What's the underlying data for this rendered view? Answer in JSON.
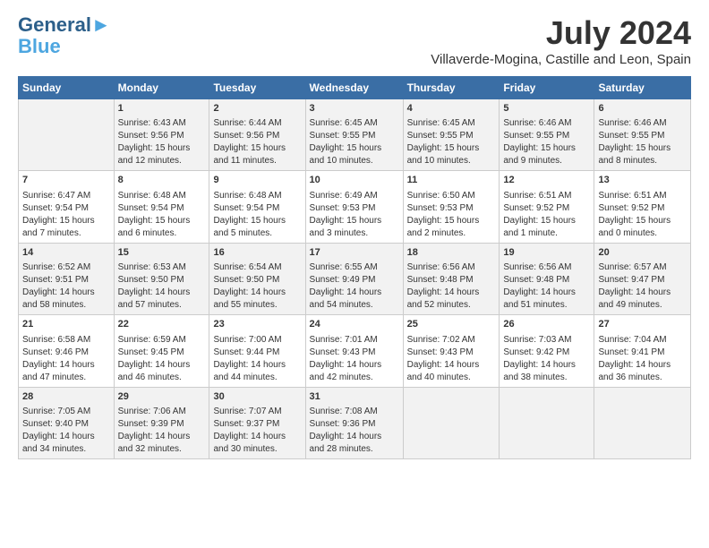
{
  "header": {
    "logo_line1": "General",
    "logo_line2": "Blue",
    "month": "July 2024",
    "location": "Villaverde-Mogina, Castille and Leon, Spain"
  },
  "days_of_week": [
    "Sunday",
    "Monday",
    "Tuesday",
    "Wednesday",
    "Thursday",
    "Friday",
    "Saturday"
  ],
  "weeks": [
    [
      {
        "day": "",
        "content": ""
      },
      {
        "day": "1",
        "content": "Sunrise: 6:43 AM\nSunset: 9:56 PM\nDaylight: 15 hours\nand 12 minutes."
      },
      {
        "day": "2",
        "content": "Sunrise: 6:44 AM\nSunset: 9:56 PM\nDaylight: 15 hours\nand 11 minutes."
      },
      {
        "day": "3",
        "content": "Sunrise: 6:45 AM\nSunset: 9:55 PM\nDaylight: 15 hours\nand 10 minutes."
      },
      {
        "day": "4",
        "content": "Sunrise: 6:45 AM\nSunset: 9:55 PM\nDaylight: 15 hours\nand 10 minutes."
      },
      {
        "day": "5",
        "content": "Sunrise: 6:46 AM\nSunset: 9:55 PM\nDaylight: 15 hours\nand 9 minutes."
      },
      {
        "day": "6",
        "content": "Sunrise: 6:46 AM\nSunset: 9:55 PM\nDaylight: 15 hours\nand 8 minutes."
      }
    ],
    [
      {
        "day": "7",
        "content": "Sunrise: 6:47 AM\nSunset: 9:54 PM\nDaylight: 15 hours\nand 7 minutes."
      },
      {
        "day": "8",
        "content": "Sunrise: 6:48 AM\nSunset: 9:54 PM\nDaylight: 15 hours\nand 6 minutes."
      },
      {
        "day": "9",
        "content": "Sunrise: 6:48 AM\nSunset: 9:54 PM\nDaylight: 15 hours\nand 5 minutes."
      },
      {
        "day": "10",
        "content": "Sunrise: 6:49 AM\nSunset: 9:53 PM\nDaylight: 15 hours\nand 3 minutes."
      },
      {
        "day": "11",
        "content": "Sunrise: 6:50 AM\nSunset: 9:53 PM\nDaylight: 15 hours\nand 2 minutes."
      },
      {
        "day": "12",
        "content": "Sunrise: 6:51 AM\nSunset: 9:52 PM\nDaylight: 15 hours\nand 1 minute."
      },
      {
        "day": "13",
        "content": "Sunrise: 6:51 AM\nSunset: 9:52 PM\nDaylight: 15 hours\nand 0 minutes."
      }
    ],
    [
      {
        "day": "14",
        "content": "Sunrise: 6:52 AM\nSunset: 9:51 PM\nDaylight: 14 hours\nand 58 minutes."
      },
      {
        "day": "15",
        "content": "Sunrise: 6:53 AM\nSunset: 9:50 PM\nDaylight: 14 hours\nand 57 minutes."
      },
      {
        "day": "16",
        "content": "Sunrise: 6:54 AM\nSunset: 9:50 PM\nDaylight: 14 hours\nand 55 minutes."
      },
      {
        "day": "17",
        "content": "Sunrise: 6:55 AM\nSunset: 9:49 PM\nDaylight: 14 hours\nand 54 minutes."
      },
      {
        "day": "18",
        "content": "Sunrise: 6:56 AM\nSunset: 9:48 PM\nDaylight: 14 hours\nand 52 minutes."
      },
      {
        "day": "19",
        "content": "Sunrise: 6:56 AM\nSunset: 9:48 PM\nDaylight: 14 hours\nand 51 minutes."
      },
      {
        "day": "20",
        "content": "Sunrise: 6:57 AM\nSunset: 9:47 PM\nDaylight: 14 hours\nand 49 minutes."
      }
    ],
    [
      {
        "day": "21",
        "content": "Sunrise: 6:58 AM\nSunset: 9:46 PM\nDaylight: 14 hours\nand 47 minutes."
      },
      {
        "day": "22",
        "content": "Sunrise: 6:59 AM\nSunset: 9:45 PM\nDaylight: 14 hours\nand 46 minutes."
      },
      {
        "day": "23",
        "content": "Sunrise: 7:00 AM\nSunset: 9:44 PM\nDaylight: 14 hours\nand 44 minutes."
      },
      {
        "day": "24",
        "content": "Sunrise: 7:01 AM\nSunset: 9:43 PM\nDaylight: 14 hours\nand 42 minutes."
      },
      {
        "day": "25",
        "content": "Sunrise: 7:02 AM\nSunset: 9:43 PM\nDaylight: 14 hours\nand 40 minutes."
      },
      {
        "day": "26",
        "content": "Sunrise: 7:03 AM\nSunset: 9:42 PM\nDaylight: 14 hours\nand 38 minutes."
      },
      {
        "day": "27",
        "content": "Sunrise: 7:04 AM\nSunset: 9:41 PM\nDaylight: 14 hours\nand 36 minutes."
      }
    ],
    [
      {
        "day": "28",
        "content": "Sunrise: 7:05 AM\nSunset: 9:40 PM\nDaylight: 14 hours\nand 34 minutes."
      },
      {
        "day": "29",
        "content": "Sunrise: 7:06 AM\nSunset: 9:39 PM\nDaylight: 14 hours\nand 32 minutes."
      },
      {
        "day": "30",
        "content": "Sunrise: 7:07 AM\nSunset: 9:37 PM\nDaylight: 14 hours\nand 30 minutes."
      },
      {
        "day": "31",
        "content": "Sunrise: 7:08 AM\nSunset: 9:36 PM\nDaylight: 14 hours\nand 28 minutes."
      },
      {
        "day": "",
        "content": ""
      },
      {
        "day": "",
        "content": ""
      },
      {
        "day": "",
        "content": ""
      }
    ]
  ]
}
